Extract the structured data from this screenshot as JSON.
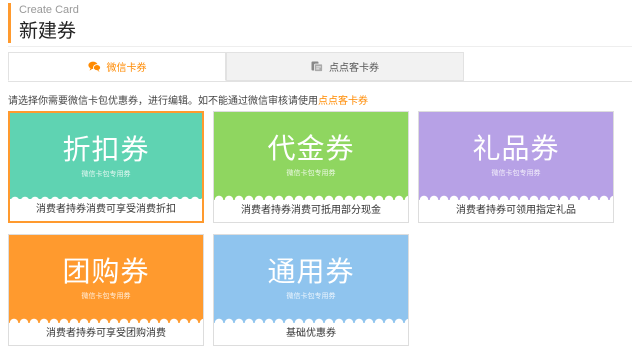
{
  "header": {
    "subtitle": "Create Card",
    "title": "新建券"
  },
  "tabs": [
    {
      "label": "微信卡券",
      "icon": "wechat-chat-icon",
      "active": true
    },
    {
      "label": "点点客卡券",
      "icon": "card-coupon-icon",
      "active": false
    }
  ],
  "instruction": {
    "text": "请选择你需要微信卡包优惠券，进行编辑。如不能通过微信审核请使用",
    "link": "点点客卡券"
  },
  "cards": [
    {
      "name": "折扣券",
      "tag": "微信卡包专用券",
      "desc": "消费者持券消费可享受消费折扣",
      "color": "#5fd3b2",
      "selected": true
    },
    {
      "name": "代金券",
      "tag": "微信卡包专用券",
      "desc": "消费者持券消费可抵用部分现金",
      "color": "#8fd660",
      "selected": false
    },
    {
      "name": "礼品券",
      "tag": "微信卡包专用券",
      "desc": "消费者持券可领用指定礼品",
      "color": "#b7a1e6",
      "selected": false
    },
    {
      "name": "团购券",
      "tag": "微信卡包专用券",
      "desc": "消费者持券可享受团购消费",
      "color": "#ff9a2e",
      "selected": false
    },
    {
      "name": "通用券",
      "tag": "微信卡包专用券",
      "desc": "基础优惠券",
      "color": "#8fc4ee",
      "selected": false
    }
  ],
  "colors": {
    "accent": "#ff8a00",
    "border": "#e2e2e2"
  }
}
